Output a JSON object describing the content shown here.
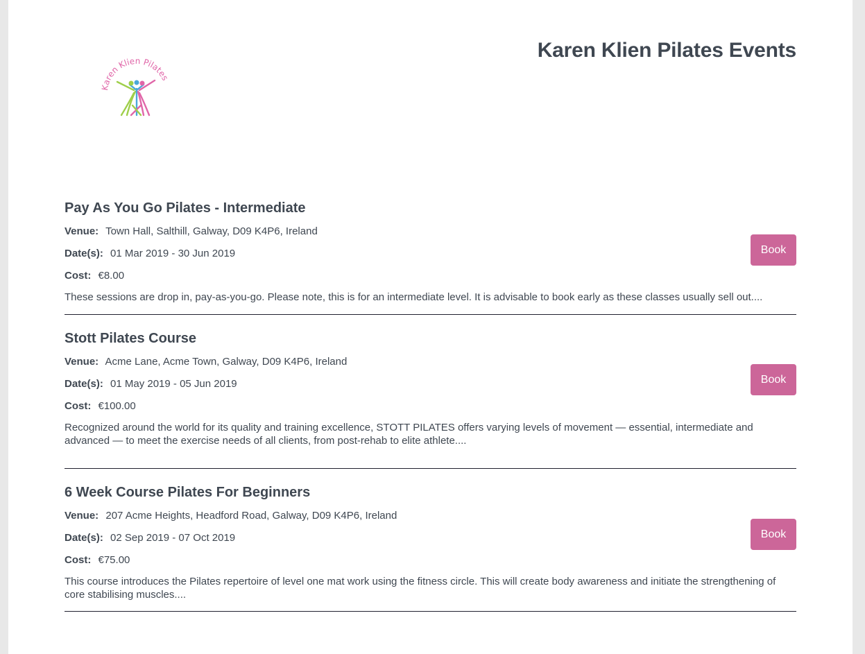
{
  "site": {
    "title": "Karen Klien Pilates Events",
    "logo_text": "Karen Klien Pilates"
  },
  "labels": {
    "venue": "Venue:",
    "dates": "Date(s):",
    "cost": "Cost:"
  },
  "events": [
    {
      "title": "Pay As You Go Pilates - Intermediate",
      "venue": "Town Hall, Salthill, Galway, D09 K4P6, Ireland",
      "dates": "01 Mar 2019 - 30 Jun 2019",
      "cost": "€8.00",
      "description": "These sessions are drop in, pay-as-you-go. Please note, this is for an intermediate level. It is advisable to book early as these classes usually sell out....",
      "book_label": "Book"
    },
    {
      "title": "Stott Pilates Course",
      "venue": "Acme Lane, Acme Town, Galway, D09 K4P6, Ireland",
      "dates": "01 May 2019 - 05 Jun 2019",
      "cost": "€100.00",
      "description": "Recognized around the world for its quality and training excellence, STOTT PILATES offers varying levels of movement — essential, intermediate and advanced — to meet the exercise needs of all clients, from post-rehab to elite athlete....",
      "book_label": "Book"
    },
    {
      "title": "6 Week Course Pilates For Beginners",
      "venue": "207 Acme Heights, Headford Road, Galway, D09 K4P6, Ireland",
      "dates": "02 Sep 2019 - 07 Oct 2019",
      "cost": "€75.00",
      "description": "This course introduces the Pilates repertoire of level one mat work using the fitness circle. This will create body awareness and initiate the strengthening of core stabilising muscles....",
      "book_label": "Book"
    }
  ],
  "colors": {
    "accent": "#cc6699",
    "text": "#3f4751",
    "logo_pink": "#e066a8",
    "logo_green": "#9fcf4a",
    "logo_blue": "#4aa8d8"
  }
}
